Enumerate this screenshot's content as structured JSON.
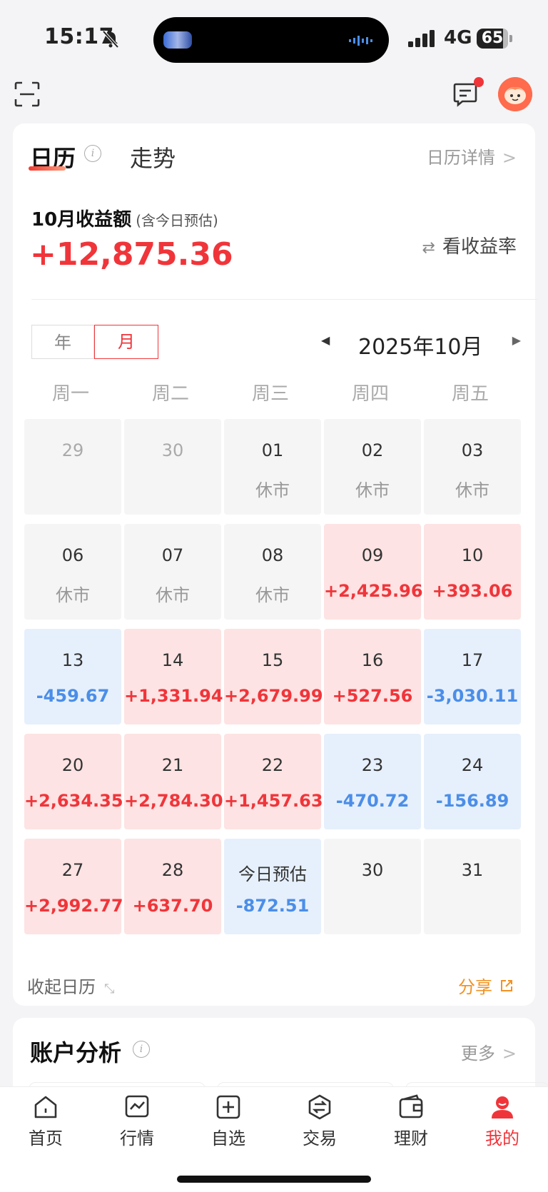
{
  "status_bar": {
    "time": "15:17",
    "network": "4G",
    "battery": "65"
  },
  "calendar_card": {
    "tab_calendar": "日历",
    "tab_trend": "走势",
    "detail_link": "日历详情",
    "income_label": "10月收益额",
    "income_note": "(含今日预估)",
    "income_amount": "+12,875.36",
    "rate_toggle": "看收益率",
    "seg_year": "年",
    "seg_month": "月",
    "month_title": "2025年10月",
    "weekdays": [
      "周一",
      "周二",
      "周三",
      "周四",
      "周五"
    ],
    "days": [
      {
        "date": "29",
        "value": "",
        "kind": "gray-dim"
      },
      {
        "date": "30",
        "value": "",
        "kind": "gray-dim"
      },
      {
        "date": "01",
        "value": "休市",
        "kind": "gray"
      },
      {
        "date": "02",
        "value": "休市",
        "kind": "gray"
      },
      {
        "date": "03",
        "value": "休市",
        "kind": "gray"
      },
      {
        "date": "06",
        "value": "休市",
        "kind": "gray"
      },
      {
        "date": "07",
        "value": "休市",
        "kind": "gray"
      },
      {
        "date": "08",
        "value": "休市",
        "kind": "gray"
      },
      {
        "date": "09",
        "value": "+2,425.96",
        "kind": "red"
      },
      {
        "date": "10",
        "value": "+393.06",
        "kind": "red"
      },
      {
        "date": "13",
        "value": "-459.67",
        "kind": "blue"
      },
      {
        "date": "14",
        "value": "+1,331.94",
        "kind": "red"
      },
      {
        "date": "15",
        "value": "+2,679.99",
        "kind": "red"
      },
      {
        "date": "16",
        "value": "+527.56",
        "kind": "red"
      },
      {
        "date": "17",
        "value": "-3,030.11",
        "kind": "blue"
      },
      {
        "date": "20",
        "value": "+2,634.35",
        "kind": "red"
      },
      {
        "date": "21",
        "value": "+2,784.30",
        "kind": "red"
      },
      {
        "date": "22",
        "value": "+1,457.63",
        "kind": "red"
      },
      {
        "date": "23",
        "value": "-470.72",
        "kind": "blue"
      },
      {
        "date": "24",
        "value": "-156.89",
        "kind": "blue"
      },
      {
        "date": "27",
        "value": "+2,992.77",
        "kind": "red"
      },
      {
        "date": "28",
        "value": "+637.70",
        "kind": "red"
      },
      {
        "date": "今日预估",
        "value": "-872.51",
        "kind": "blue"
      },
      {
        "date": "30",
        "value": "",
        "kind": "gray"
      },
      {
        "date": "31",
        "value": "",
        "kind": "gray"
      }
    ],
    "collapse_label": "收起日历",
    "share_label": "分享"
  },
  "analysis_card": {
    "title": "账户分析",
    "more_link": "更多"
  },
  "tabbar": {
    "items": [
      {
        "label": "首页",
        "icon": "home-icon"
      },
      {
        "label": "行情",
        "icon": "chart-icon"
      },
      {
        "label": "自选",
        "icon": "add-square-icon"
      },
      {
        "label": "交易",
        "icon": "exchange-icon"
      },
      {
        "label": "理财",
        "icon": "wallet-icon"
      },
      {
        "label": "我的",
        "icon": "profile-icon"
      }
    ],
    "active_index": 5
  },
  "colors": {
    "up_red": "#f0353a",
    "down_blue": "#4b8ee8",
    "accent_orange": "#f29222"
  }
}
